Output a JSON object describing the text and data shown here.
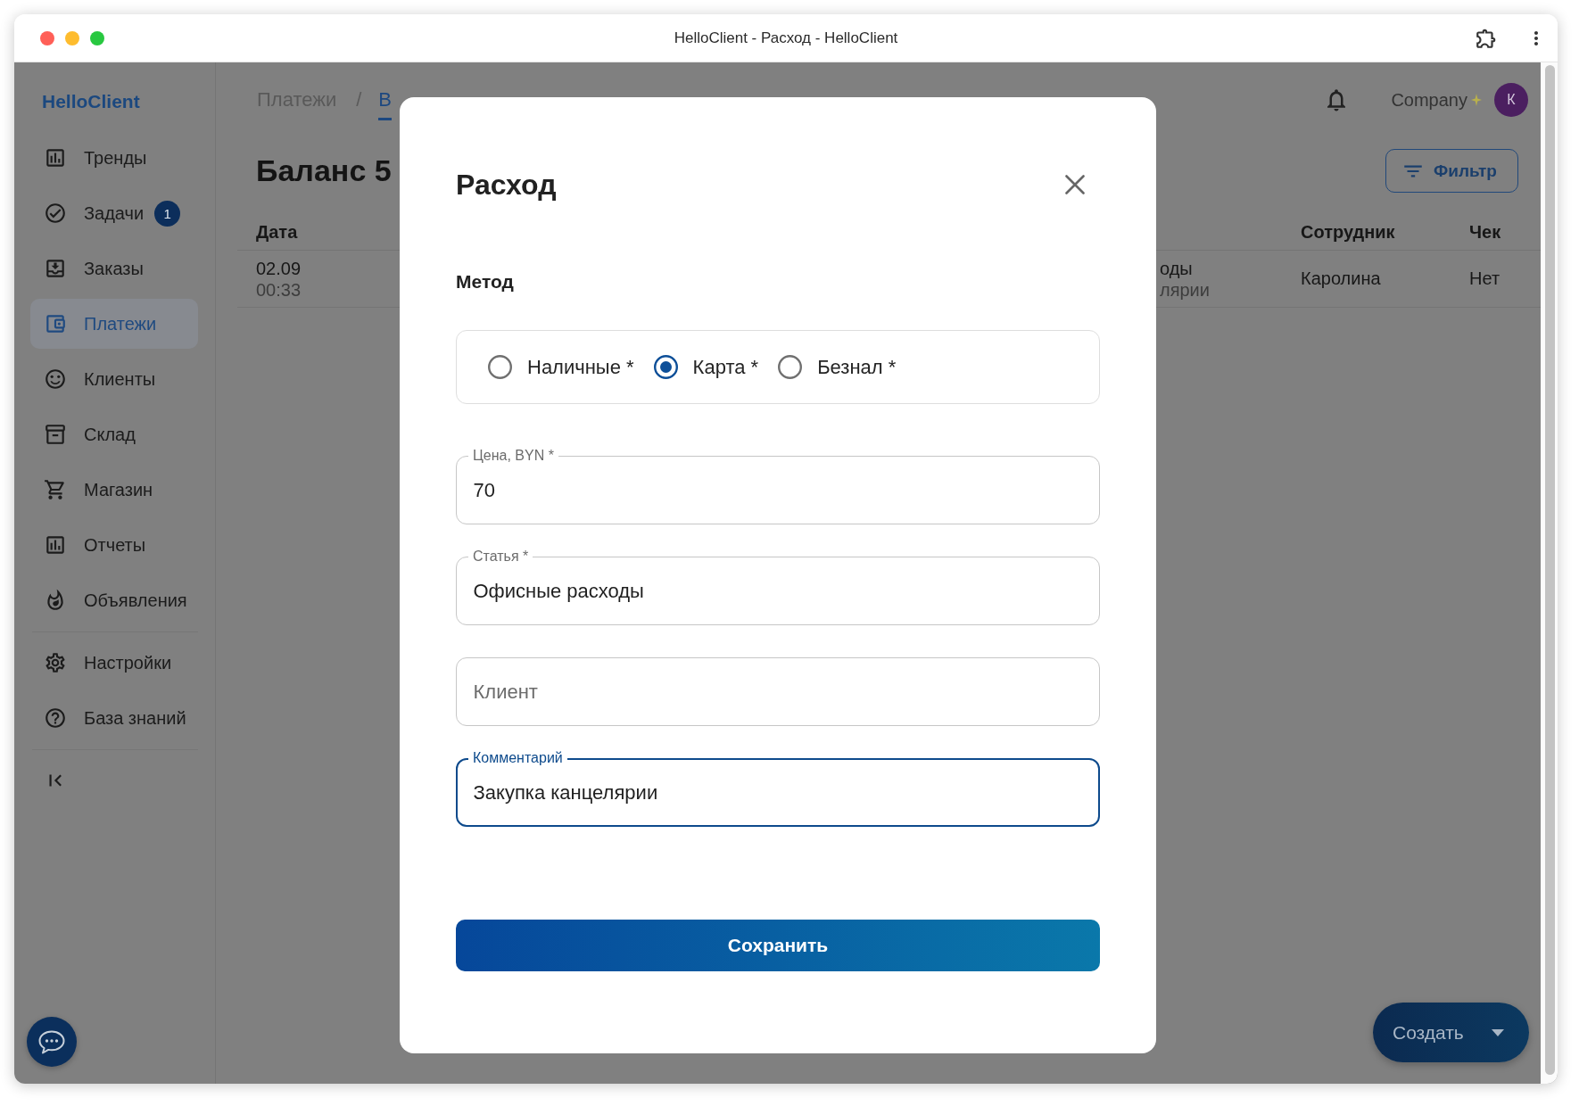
{
  "window": {
    "title": "HelloClient - Расход - HelloClient"
  },
  "sidebar": {
    "logo": "HelloClient",
    "sections": [
      {
        "items": [
          {
            "label": "Тренды",
            "selected": false
          },
          {
            "label": "Задачи",
            "selected": false,
            "badge": "1"
          },
          {
            "label": "Заказы",
            "selected": false
          },
          {
            "label": "Платежи",
            "selected": true
          },
          {
            "label": "Клиенты",
            "selected": false
          },
          {
            "label": "Склад",
            "selected": false
          },
          {
            "label": "Магазин",
            "selected": false
          },
          {
            "label": "Отчеты",
            "selected": false
          },
          {
            "label": "Объявления",
            "selected": false
          }
        ]
      },
      {
        "items": [
          {
            "label": "Настройки",
            "selected": false
          },
          {
            "label": "База знаний",
            "selected": false
          }
        ]
      }
    ]
  },
  "header": {
    "breadcrumb": {
      "section": "Платежи",
      "separator": "/"
    },
    "tabs": [
      {
        "label": "В",
        "selected": true
      }
    ],
    "account": {
      "company": "Company",
      "avatar_letter": "К"
    }
  },
  "page": {
    "title": "Баланс 5",
    "filter_button": "Фильтр"
  },
  "table": {
    "columns": {
      "date": "Дата",
      "employee": "Сотрудник",
      "receipt": "Чек"
    },
    "rows": [
      {
        "date": "02.09",
        "time": "00:33",
        "column_2": [
          "оды",
          "лярии"
        ],
        "employee": "Каролина",
        "receipt": "Нет"
      }
    ]
  },
  "dialog": {
    "title": "Расход",
    "method": {
      "label": "Метод",
      "options": [
        {
          "label": "Наличные *",
          "selected": false
        },
        {
          "label": "Карта *",
          "selected": true
        },
        {
          "label": "Безнал *",
          "selected": false
        }
      ]
    },
    "fields": [
      {
        "label": "Цена, BYN *",
        "value": "70",
        "focused": false
      },
      {
        "label": "Статья *",
        "value": "Офисные расходы",
        "focused": false
      },
      {
        "placeholder": "Клиент",
        "focused": false
      },
      {
        "label": "Комментарий",
        "value": "Закупка канцелярии",
        "focused": true
      }
    ],
    "save_button": "Сохранить"
  },
  "create_button": "Создать"
}
